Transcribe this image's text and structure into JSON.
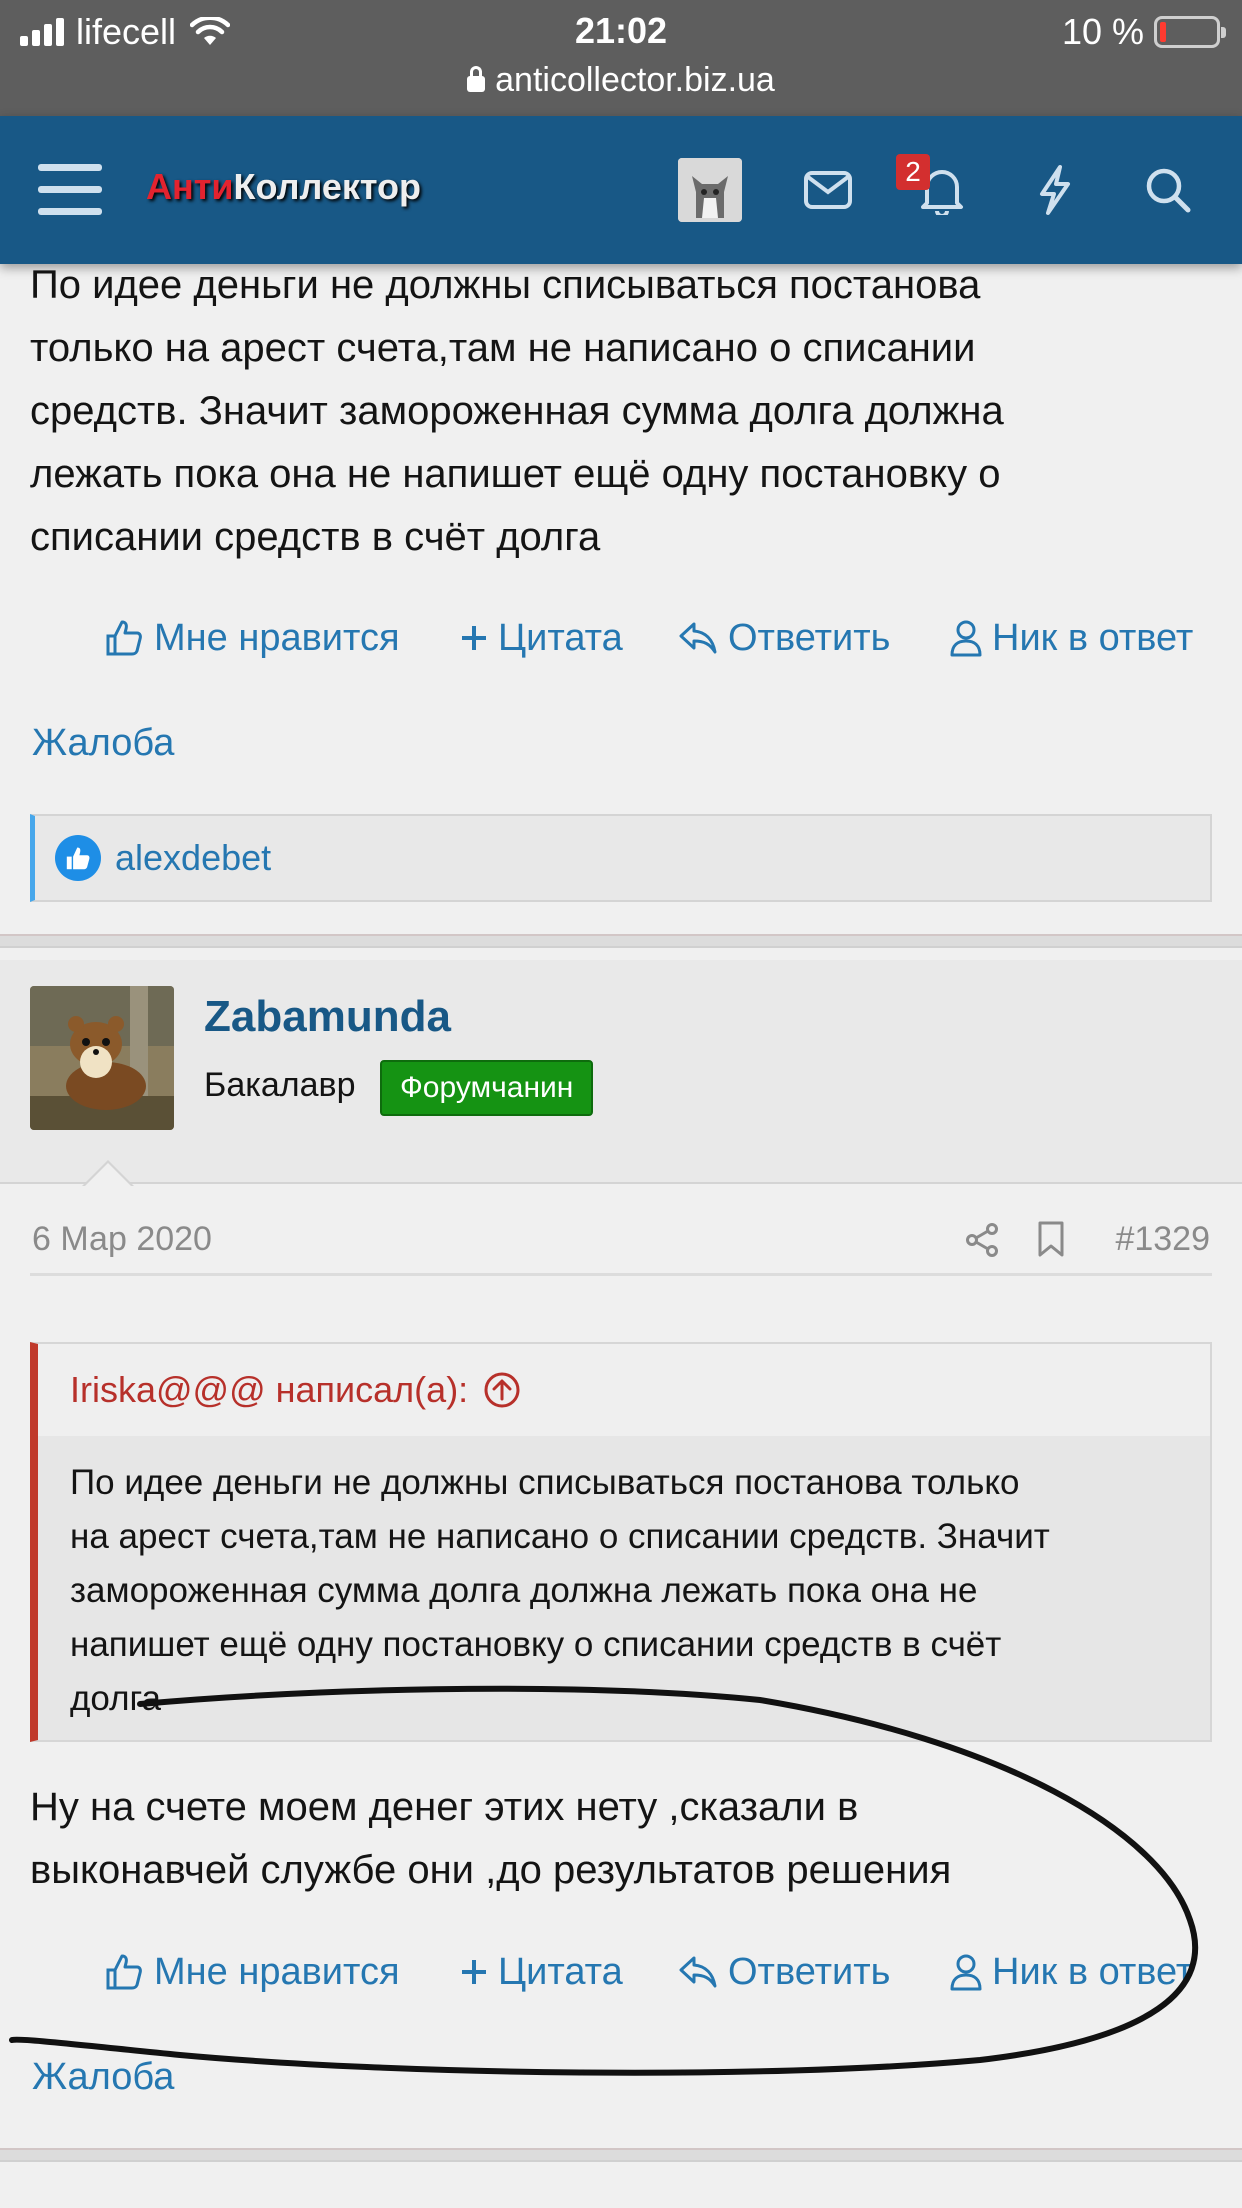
{
  "status_bar": {
    "carrier": "lifecell",
    "time": "21:02",
    "battery": "10 %",
    "url": "anticollector.biz.ua"
  },
  "header": {
    "logo_red": "Анти",
    "logo_white": "Коллектор",
    "notification_count": "2"
  },
  "previous_post": {
    "text_lines": [
      "По идее деньги не должны списываться постанова",
      "только на арест счета,там не написано о списании",
      "средств. Значит замороженная сумма долга должна",
      "лежать пока она не напишет ещё одну постановку о",
      "списании средств в счёт долга"
    ],
    "actions": {
      "like": "Мне нравится",
      "quote": "Цитата",
      "reply": "Ответить",
      "mention": "Ник в ответ"
    },
    "complain": "Жалоба",
    "reaction_user": "alexdebet"
  },
  "post": {
    "username": "Zabamunda",
    "user_title": "Бакалавр",
    "user_banner": "Форумчанин",
    "date": "6 Мар 2020",
    "number": "#1329",
    "quote": {
      "author": "Iriska@@@ написал(а):",
      "lines": [
        "По идее деньги не должны списываться постанова только",
        "на арест счета,там не написано о списании средств. Значит",
        "замороженная сумма долга должна лежать пока она не",
        "напишет ещё одну постановку о списании средств в счёт",
        "долга"
      ]
    },
    "text_lines": [
      "Ну на счете моем денег этих нету ,сказали в",
      "выконавчей службе они ,до результатов решения"
    ],
    "actions": {
      "like": "Мне нравится",
      "quote": "Цитата",
      "reply": "Ответить",
      "mention": "Ник в ответ"
    },
    "complain": "Жалоба"
  },
  "colors": {
    "header": "#185886",
    "link": "#2577b1",
    "quote_accent": "#c0392b",
    "banner_green": "#159313",
    "badge_red": "#d32f2f"
  }
}
